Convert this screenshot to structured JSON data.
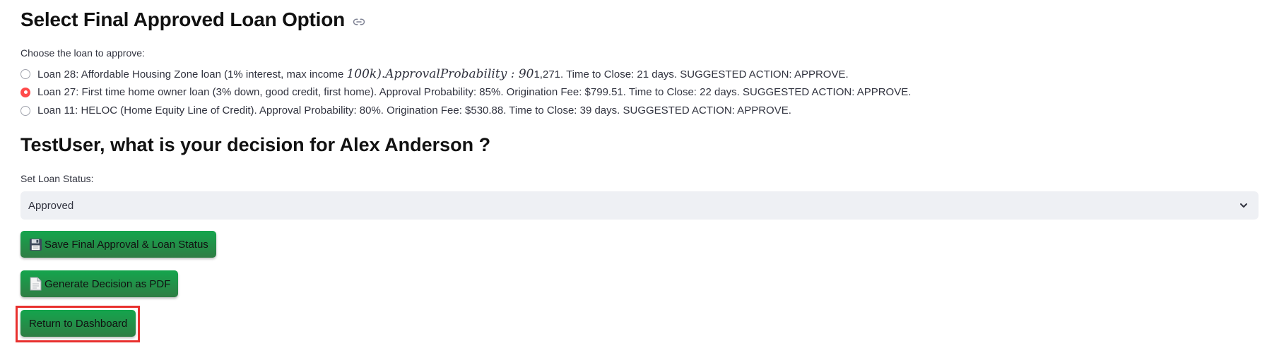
{
  "section_title": "Select Final Approved Loan Option",
  "icons": {
    "title_link": "link-icon",
    "save_button": "floppy-disk-icon",
    "pdf_button": "document-icon",
    "select_chevron": "chevron-down-icon"
  },
  "loan_choice": {
    "label": "Choose the loan to approve:",
    "options": [
      {
        "text_plain": "Loan 28: Affordable Housing Zone loan (1% interest, max income ",
        "text_math": "100k).ApprovalProbability : 90",
        "text_tail": "1,271. Time to Close: 21 days. SUGGESTED ACTION: APPROVE.",
        "selected": false
      },
      {
        "text": "Loan 27: First time home owner loan (3% down, good credit, first home). Approval Probability: 85%. Origination Fee: $799.51. Time to Close: 22 days. SUGGESTED ACTION: APPROVE.",
        "selected": true
      },
      {
        "text": "Loan 11: HELOC (Home Equity Line of Credit). Approval Probability: 80%. Origination Fee: $530.88. Time to Close: 39 days. SUGGESTED ACTION: APPROVE.",
        "selected": false
      }
    ]
  },
  "decision_heading": "TestUser, what is your decision for Alex Anderson ?",
  "loan_status": {
    "label": "Set Loan Status:",
    "value": "Approved"
  },
  "buttons": {
    "save": "Save Final Approval & Loan Status",
    "pdf": "Generate Decision as PDF",
    "dashboard": "Return to Dashboard"
  },
  "colors": {
    "accent_radio": "#ff4b4b",
    "button_green": "#14a54d",
    "highlight_red": "#e8302e",
    "select_bg": "#eef0f4"
  }
}
